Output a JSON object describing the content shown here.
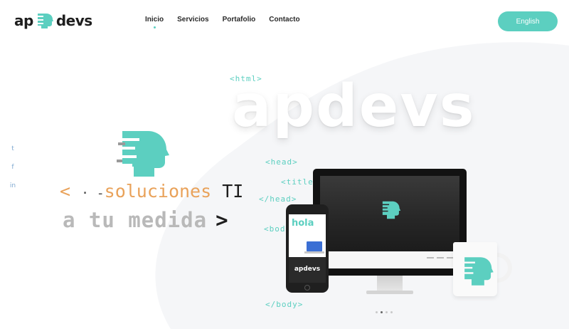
{
  "brand": {
    "logo_left": "ap",
    "logo_right": "devs",
    "accent_color": "#5ccfc0",
    "orange_color": "#e9a25a"
  },
  "nav": {
    "items": [
      {
        "label": "Inicio",
        "active": true
      },
      {
        "label": "Servicios",
        "active": false
      },
      {
        "label": "Portafolio",
        "active": false
      },
      {
        "label": "Contacto",
        "active": false
      }
    ]
  },
  "language_button": "English",
  "social": {
    "icons": [
      {
        "name": "twitter-icon",
        "glyph": "t"
      },
      {
        "name": "facebook-icon",
        "glyph": "f"
      },
      {
        "name": "linkedin-icon",
        "glyph": "in"
      }
    ]
  },
  "hero": {
    "big_word": "apdevs",
    "code_tags": {
      "html_open": "<html>",
      "head_open": "<head>",
      "title_open": "<title",
      "head_close": "</head>",
      "body_open": "<bod",
      "body_close": "</body>"
    },
    "tagline": {
      "open_bracket": "<",
      "dots": "· -",
      "word": "soluciones",
      "ti": "TI",
      "line2": "a tu medida",
      "close_bracket": ">"
    }
  },
  "devices": {
    "phone_greeting": "hola",
    "phone_brand": "apdevs"
  },
  "carousel": {
    "slides": 4,
    "active_index": 1
  }
}
